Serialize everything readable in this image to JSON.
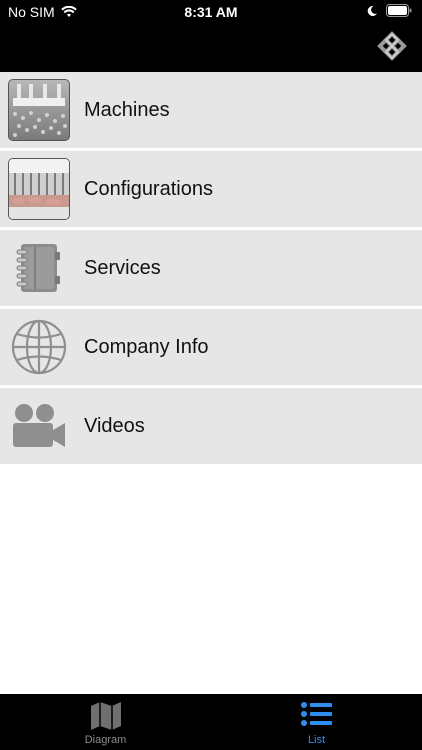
{
  "status_bar": {
    "carrier": "No SIM",
    "time": "8:31 AM"
  },
  "menu": {
    "items": [
      {
        "label": "Machines",
        "icon": "machines-photo"
      },
      {
        "label": "Configurations",
        "icon": "configurations-photo"
      },
      {
        "label": "Services",
        "icon": "binder-icon"
      },
      {
        "label": "Company Info",
        "icon": "globe-icon"
      },
      {
        "label": "Videos",
        "icon": "video-camera-icon"
      }
    ]
  },
  "tab_bar": {
    "tabs": [
      {
        "label": "Diagram",
        "icon": "map-icon",
        "active": false
      },
      {
        "label": "List",
        "icon": "list-icon",
        "active": true
      }
    ]
  },
  "colors": {
    "bar_background": "#000000",
    "row_background": "#e6e6e6",
    "active_tab": "#2f8ff0",
    "inactive_tab": "#8a8a8a"
  }
}
